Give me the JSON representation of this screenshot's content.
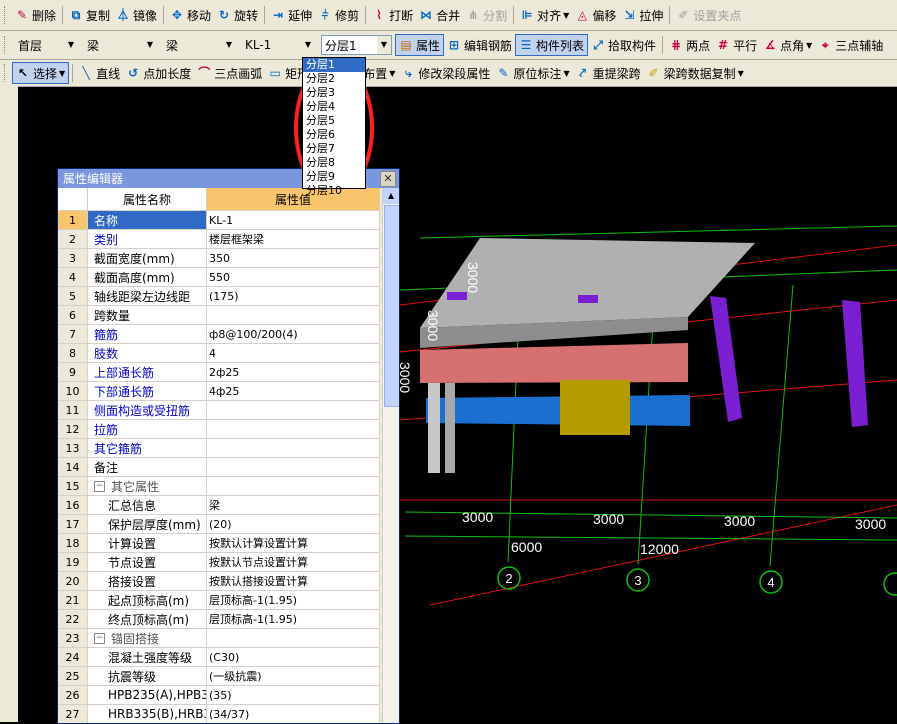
{
  "toolbar1": {
    "items": [
      "删除",
      "复制",
      "镜像",
      "移动",
      "旋转",
      "延伸",
      "修剪",
      "打断",
      "合并",
      "分割",
      "对齐",
      "偏移",
      "拉伸",
      "设置夹点"
    ]
  },
  "toolbar2": {
    "floor": "首层",
    "type1": "梁",
    "type2": "梁",
    "component": "KL-1",
    "layer": "分层1",
    "buttons": [
      "属性",
      "编辑钢筋",
      "构件列表",
      "拾取构件",
      "两点",
      "平行",
      "点角",
      "三点辅轴"
    ]
  },
  "toolbar3": {
    "buttons": [
      "选择",
      "直线",
      "点加长度",
      "三点画弧",
      "矩形",
      "智能布置",
      "修改梁段属性",
      "原位标注",
      "重提梁跨",
      "梁跨数据复制"
    ]
  },
  "dropdown": {
    "options": [
      "分层1",
      "分层2",
      "分层3",
      "分层4",
      "分层5",
      "分层6",
      "分层7",
      "分层8",
      "分层9",
      "分层10"
    ]
  },
  "editor": {
    "title": "属性编辑器",
    "col_name": "属性名称",
    "col_value": "属性值",
    "rows": [
      {
        "n": "1",
        "name": "名称",
        "value": "KL-1"
      },
      {
        "n": "2",
        "name": "类别",
        "value": "楼层框架梁"
      },
      {
        "n": "3",
        "name": "截面宽度(mm)",
        "value": "350"
      },
      {
        "n": "4",
        "name": "截面高度(mm)",
        "value": "550"
      },
      {
        "n": "5",
        "name": "轴线距梁左边线距",
        "value": "(175)"
      },
      {
        "n": "6",
        "name": "跨数量",
        "value": ""
      },
      {
        "n": "7",
        "name": "箍筋",
        "value": "ф8@100/200(4)"
      },
      {
        "n": "8",
        "name": "肢数",
        "value": "4"
      },
      {
        "n": "9",
        "name": "上部通长筋",
        "value": "2ф25"
      },
      {
        "n": "10",
        "name": "下部通长筋",
        "value": "4ф25"
      },
      {
        "n": "11",
        "name": "侧面构造或受扭筋",
        "value": ""
      },
      {
        "n": "12",
        "name": "拉筋",
        "value": ""
      },
      {
        "n": "13",
        "name": "其它箍筋",
        "value": ""
      },
      {
        "n": "14",
        "name": "备注",
        "value": ""
      },
      {
        "n": "15",
        "name": "其它属性",
        "value": ""
      },
      {
        "n": "16",
        "name": "汇总信息",
        "value": "梁"
      },
      {
        "n": "17",
        "name": "保护层厚度(mm)",
        "value": "(20)"
      },
      {
        "n": "18",
        "name": "计算设置",
        "value": "按默认计算设置计算"
      },
      {
        "n": "19",
        "name": "节点设置",
        "value": "按默认节点设置计算"
      },
      {
        "n": "20",
        "name": "搭接设置",
        "value": "按默认搭接设置计算"
      },
      {
        "n": "21",
        "name": "起点顶标高(m)",
        "value": "层顶标高-1(1.95)"
      },
      {
        "n": "22",
        "name": "终点顶标高(m)",
        "value": "层顶标高-1(1.95)"
      },
      {
        "n": "23",
        "name": "锚固搭接",
        "value": ""
      },
      {
        "n": "24",
        "name": "混凝土强度等级",
        "value": "(C30)"
      },
      {
        "n": "25",
        "name": "抗震等级",
        "value": "(一级抗震)"
      },
      {
        "n": "26",
        "name": "HPB235(A),HPB3",
        "value": "(35)"
      },
      {
        "n": "27",
        "name": "HRB335(B),HRB3",
        "value": "(34/37)"
      }
    ]
  },
  "canvas": {
    "dims": [
      "3000",
      "3000",
      "3000",
      "3000",
      "6000",
      "12000",
      "3000",
      "3000",
      "3000"
    ],
    "axes": [
      "2",
      "3",
      "4"
    ]
  }
}
